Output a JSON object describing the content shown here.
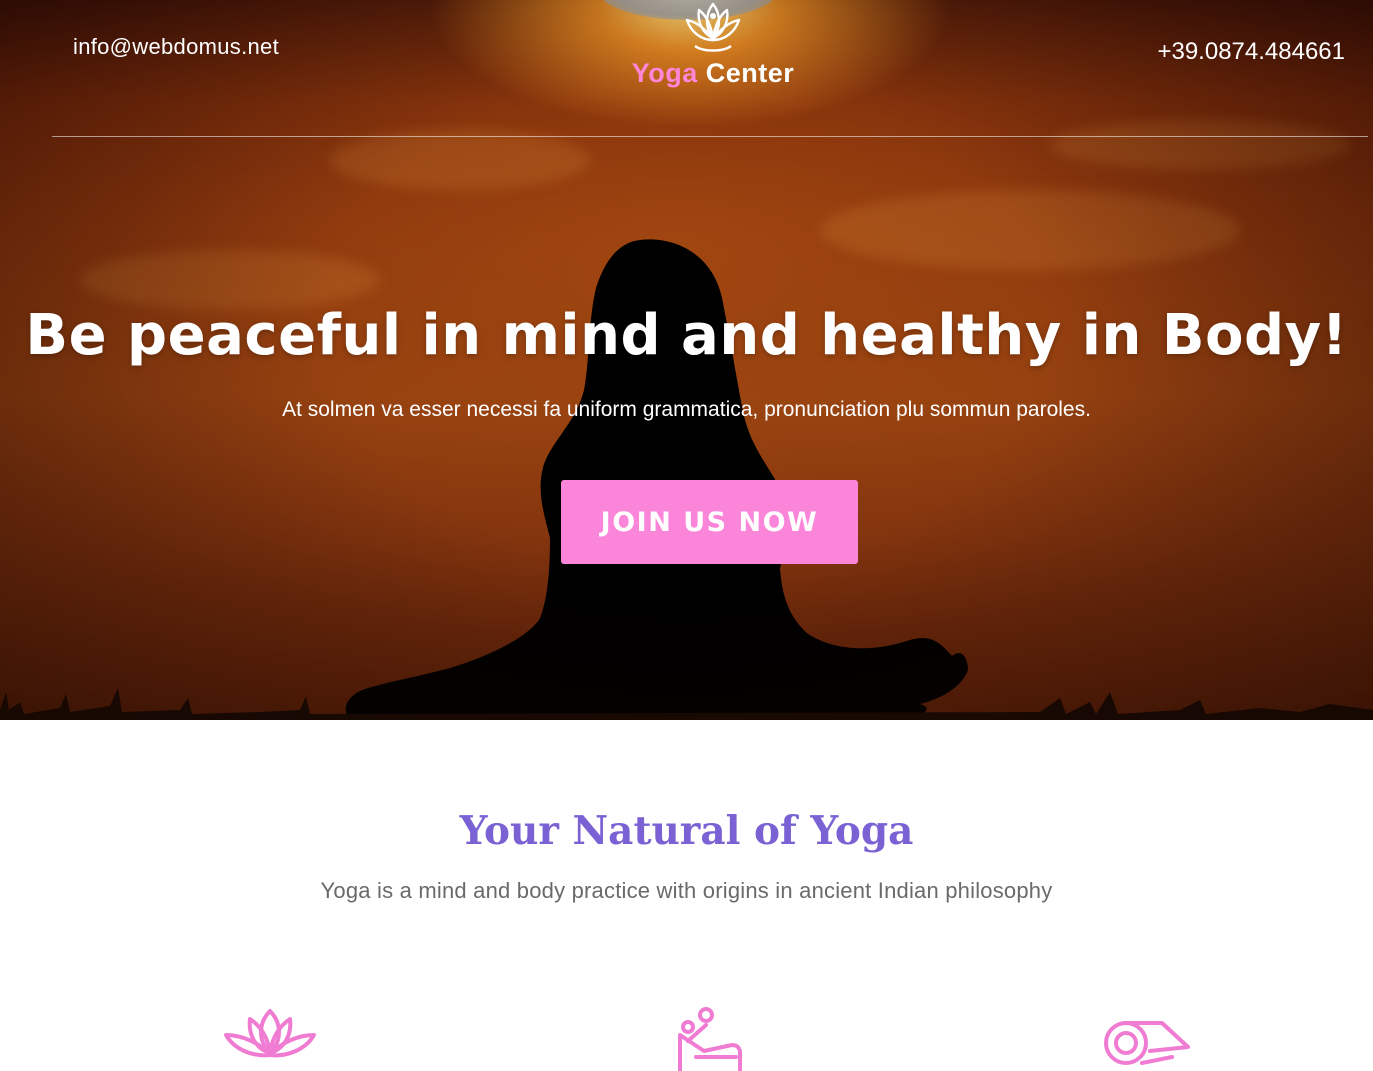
{
  "header": {
    "email": "info@webdomus.net",
    "phone": "+39.0874.484661",
    "logo": {
      "word_a": "Yoga",
      "word_b": "Center",
      "icon": "lotus-figure-icon"
    }
  },
  "hero": {
    "title": "Be peaceful in mind and healthy in Body!",
    "subtitle": "At solmen va esser necessi fa uniform grammatica, pronunciation plu sommun paroles.",
    "cta_label": "JOIN US NOW"
  },
  "intro": {
    "title": "Your Natural of Yoga",
    "text": "Yoga is a mind and body practice with origins in ancient Indian philosophy",
    "features": [
      {
        "icon": "lotus-icon"
      },
      {
        "icon": "massage-icon"
      },
      {
        "icon": "yoga-mat-icon"
      }
    ]
  },
  "colors": {
    "accent_pink": "#fb85d9",
    "heading_purple": "#7a62d4",
    "body_gray": "#6a6a6a"
  }
}
